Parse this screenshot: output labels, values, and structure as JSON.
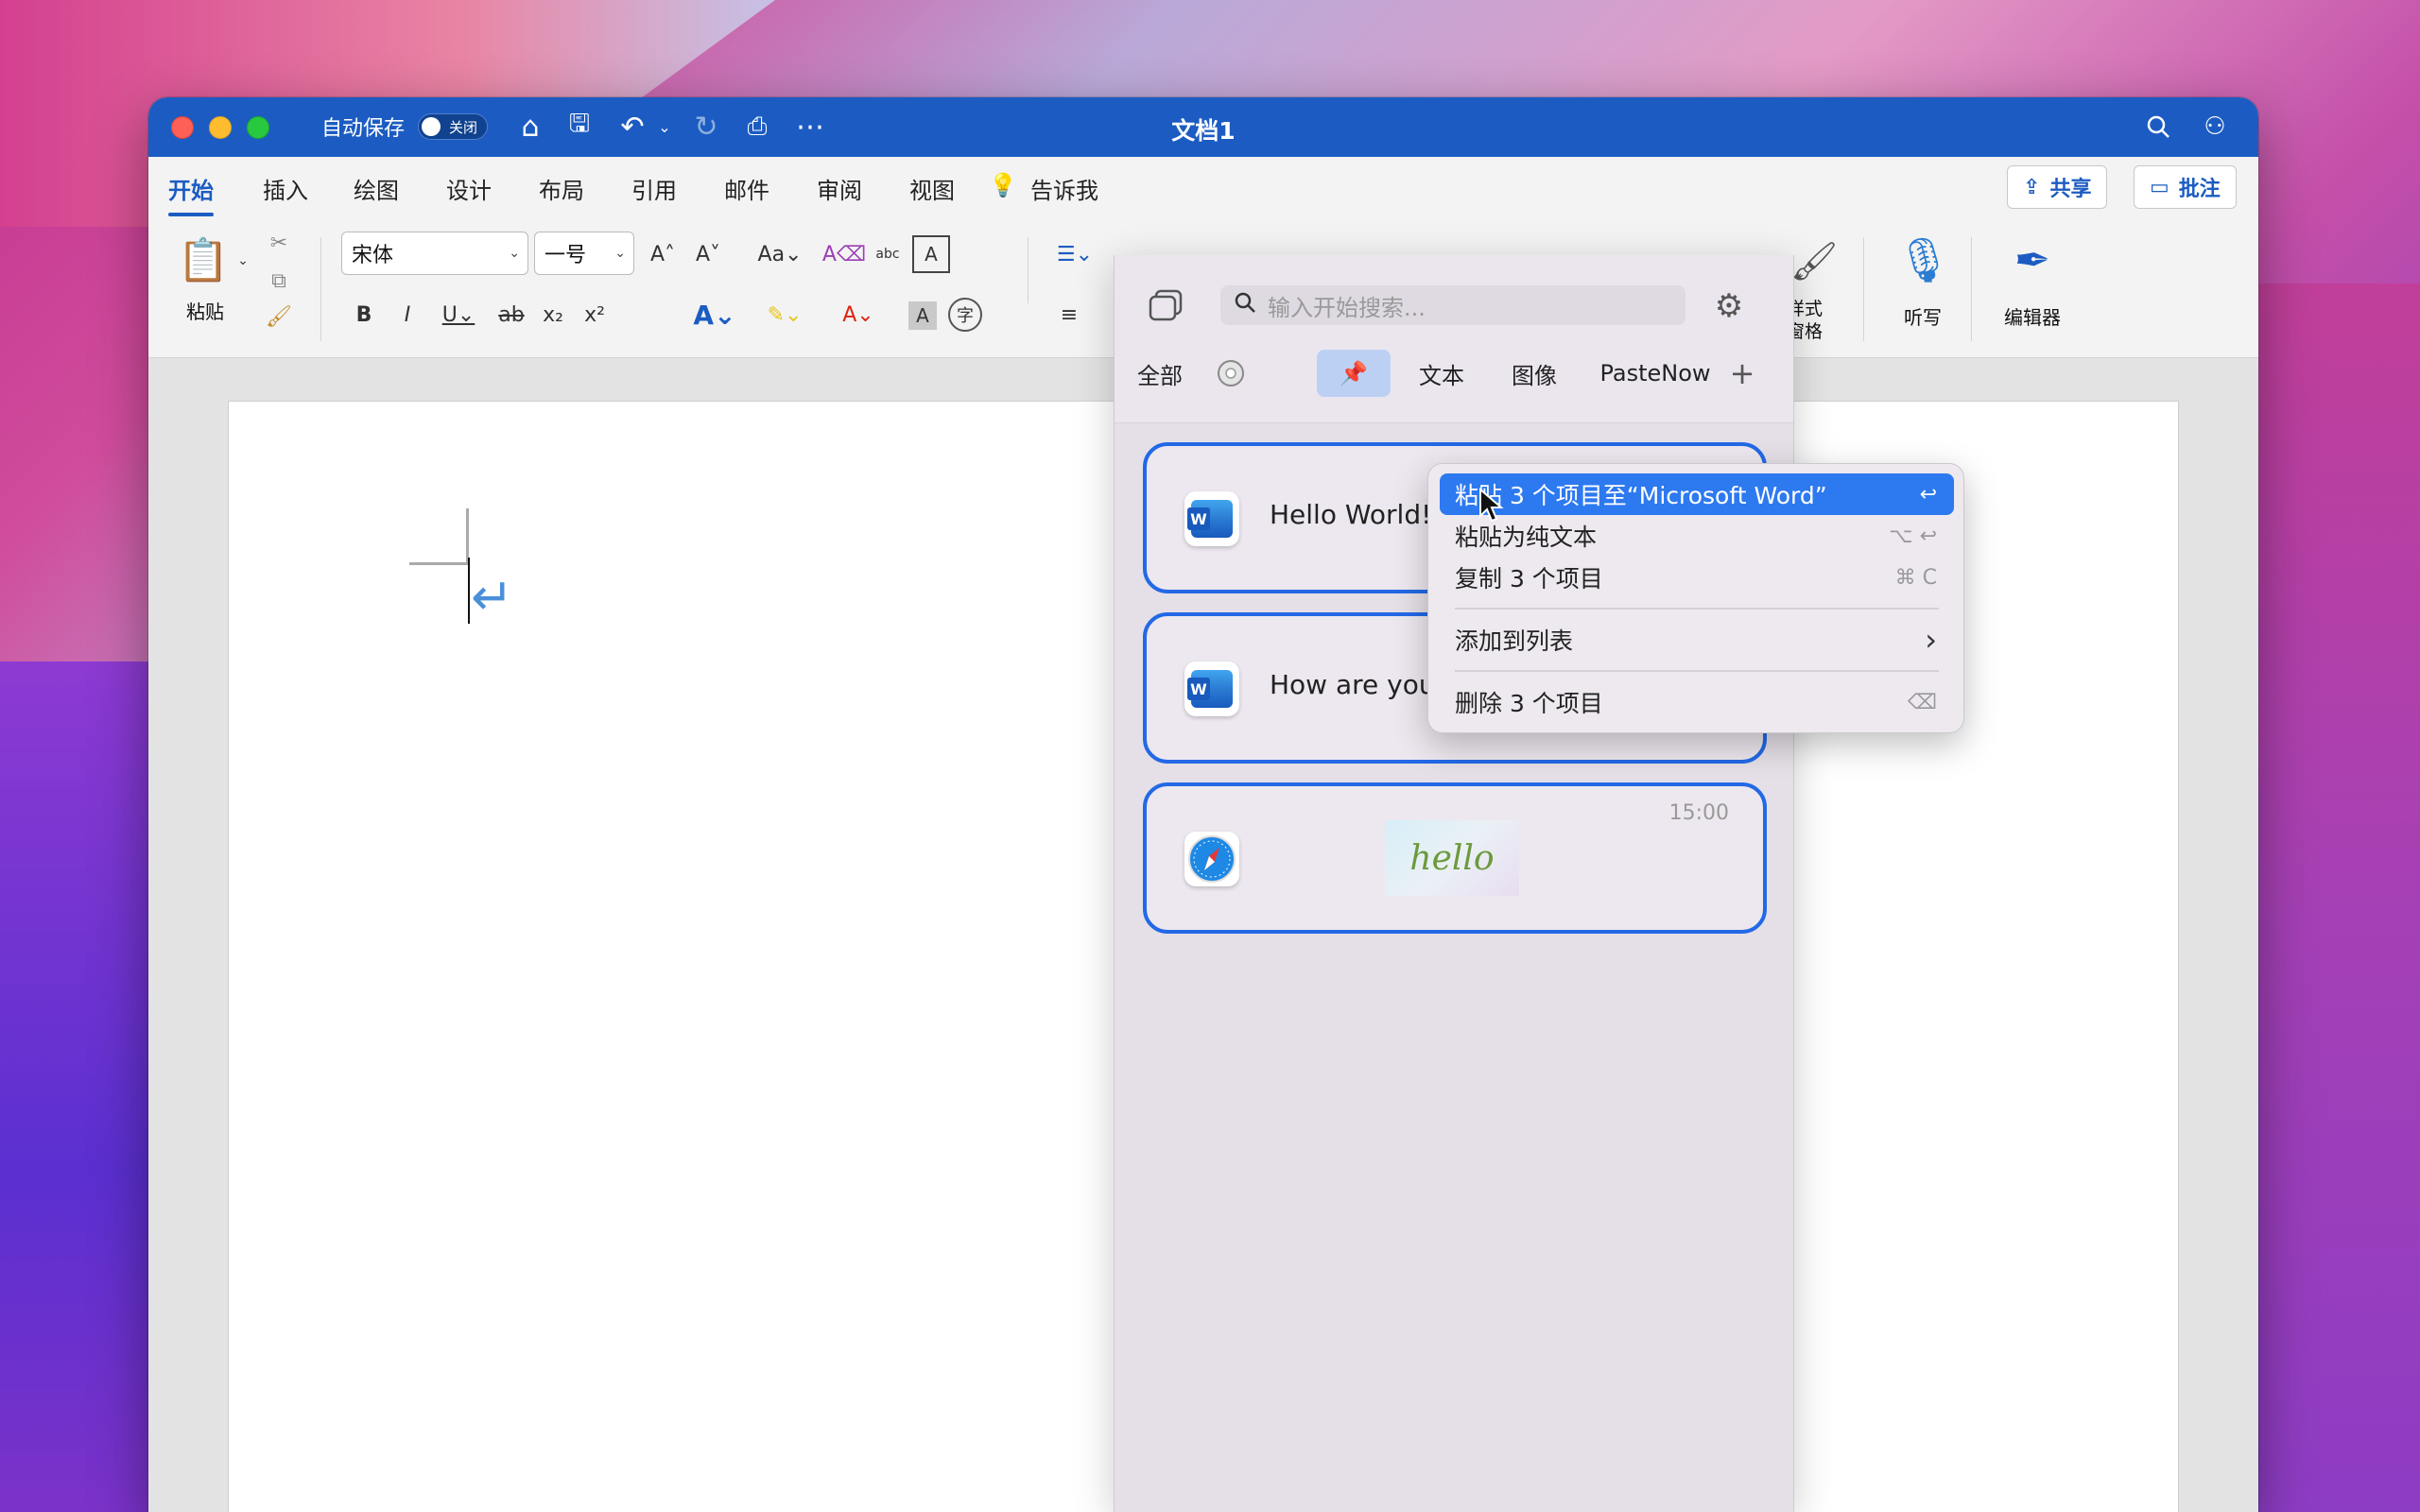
{
  "window": {
    "title": "文档1",
    "autosave_label": "自动保存",
    "autosave_state": "关闭"
  },
  "colors": {
    "accent": "#1c5cc2",
    "highlight": "#2d79f0",
    "card_border": "#2369e6"
  },
  "ribbon_tabs": [
    "开始",
    "插入",
    "绘图",
    "设计",
    "布局",
    "引用",
    "邮件",
    "审阅",
    "视图"
  ],
  "tell_me": "告诉我",
  "share_label": "共享",
  "comments_label": "批注",
  "ribbon": {
    "paste": "粘贴",
    "font": "宋体",
    "size": "一号",
    "styles_pane": "样式\n窗格",
    "dictate": "听写",
    "editor": "编辑器"
  },
  "panel": {
    "search_placeholder": "输入开始搜索...",
    "filters": [
      "全部",
      "文本",
      "图像",
      "PasteNow"
    ],
    "cards": [
      {
        "text": "Hello World!"
      },
      {
        "text": "How are you?"
      },
      {
        "time": "15:00",
        "image_text": "hello"
      }
    ]
  },
  "context_menu": {
    "items": [
      {
        "label": "粘贴 3 个项目至“Microsoft Word”",
        "shortcut": "↩"
      },
      {
        "label": "粘贴为纯文本",
        "shortcut": "⌥ ↩"
      },
      {
        "label": "复制 3 个项目",
        "shortcut": "⌘ C"
      },
      {
        "label": "添加到列表",
        "shortcut": "›"
      },
      {
        "label": "删除 3 个项目",
        "shortcut": "⌫"
      }
    ]
  }
}
